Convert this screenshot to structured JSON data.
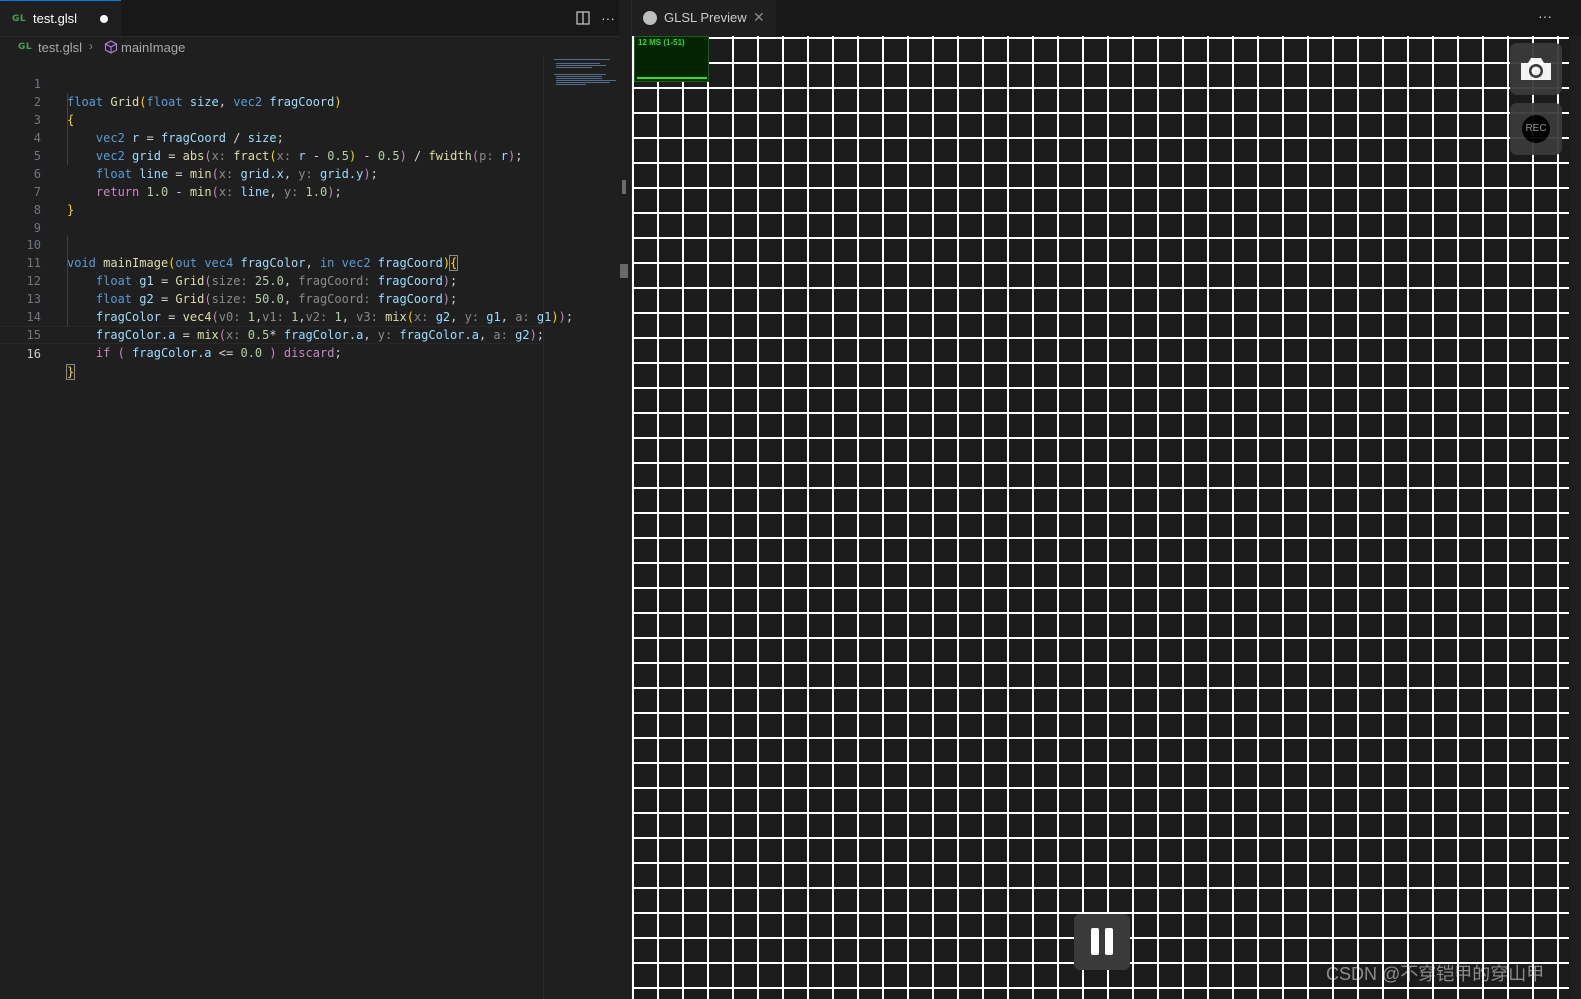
{
  "editor": {
    "tab": {
      "badge": "GL",
      "filename": "test.glsl"
    },
    "toolbar": {
      "split_icon": "split-editor-icon",
      "more_icon": "more-actions-icon",
      "more_label": "···"
    },
    "breadcrumb": {
      "badge": "GL",
      "file": "test.glsl",
      "separator": "›",
      "symbol_icon": "method-cube-icon",
      "symbol": "mainImage"
    },
    "line_numbers": [
      "1",
      "2",
      "3",
      "4",
      "5",
      "6",
      "7",
      "8",
      "9",
      "10",
      "11",
      "12",
      "13",
      "14",
      "15",
      "16"
    ],
    "current_line": "16"
  },
  "preview": {
    "tab": {
      "icon": "glsl-preview-icon",
      "label": "GLSL Preview",
      "close": "✕"
    },
    "more_label": "···",
    "stats_label": "12 MS (1-51)",
    "rec_label": "REC",
    "watermark": "CSDN @不穿铠甲的穿山甲",
    "colors": {
      "grid_line": "#ffffff",
      "canvas_bg": "#1b1b1b",
      "stats_green": "#27e327"
    }
  }
}
